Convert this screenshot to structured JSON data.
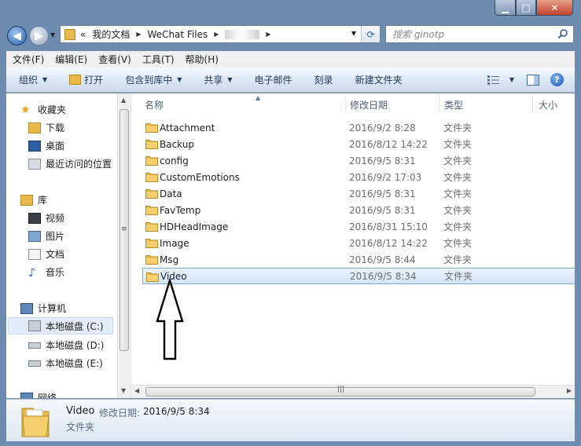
{
  "window": {
    "caption": {
      "minimize": "▁",
      "maximize": "□",
      "close": "✕"
    }
  },
  "address_bar": {
    "chevron": "«",
    "segments": [
      "我的文档",
      "WeChat Files"
    ],
    "search_placeholder": "搜索 ginotp"
  },
  "menu": [
    "文件(F)",
    "编辑(E)",
    "查看(V)",
    "工具(T)",
    "帮助(H)"
  ],
  "toolbar": {
    "organize": "组织",
    "open": "打开",
    "include_library": "包含到库中",
    "share": "共享",
    "email": "电子邮件",
    "burn": "刻录",
    "new_folder": "新建文件夹"
  },
  "sidebar": {
    "favorites": "收藏夹",
    "downloads": "下载",
    "desktop": "桌面",
    "recent": "最近访问的位置",
    "libraries": "库",
    "videos": "视频",
    "pictures": "图片",
    "documents": "文档",
    "music": "音乐",
    "computer": "计算机",
    "drive_c": "本地磁盘 (C:)",
    "drive_d": "本地磁盘 (D:)",
    "drive_e": "本地磁盘 (E:)",
    "network": "网络"
  },
  "columns": {
    "name": "名称",
    "date": "修改日期",
    "type": "类型",
    "size": "大小"
  },
  "files": [
    {
      "name": "Attachment",
      "date": "2016/9/2 8:28",
      "type": "文件夹"
    },
    {
      "name": "Backup",
      "date": "2016/8/12 14:22",
      "type": "文件夹"
    },
    {
      "name": "config",
      "date": "2016/9/5 8:31",
      "type": "文件夹"
    },
    {
      "name": "CustomEmotions",
      "date": "2016/9/2 17:03",
      "type": "文件夹"
    },
    {
      "name": "Data",
      "date": "2016/9/5 8:31",
      "type": "文件夹"
    },
    {
      "name": "FavTemp",
      "date": "2016/9/5 8:31",
      "type": "文件夹"
    },
    {
      "name": "HDHeadImage",
      "date": "2016/8/31 15:10",
      "type": "文件夹"
    },
    {
      "name": "Image",
      "date": "2016/8/12 14:22",
      "type": "文件夹"
    },
    {
      "name": "Msg",
      "date": "2016/9/5 8:44",
      "type": "文件夹"
    },
    {
      "name": "Video",
      "date": "2016/9/5 8:34",
      "type": "文件夹"
    }
  ],
  "details": {
    "name": "Video",
    "date_label": "修改日期:",
    "date": "2016/9/5 8:34",
    "type": "文件夹"
  },
  "colors": {
    "folder": "#e8b94a",
    "selection": "#d3e5fa",
    "toolbar_text": "#1e395b"
  }
}
